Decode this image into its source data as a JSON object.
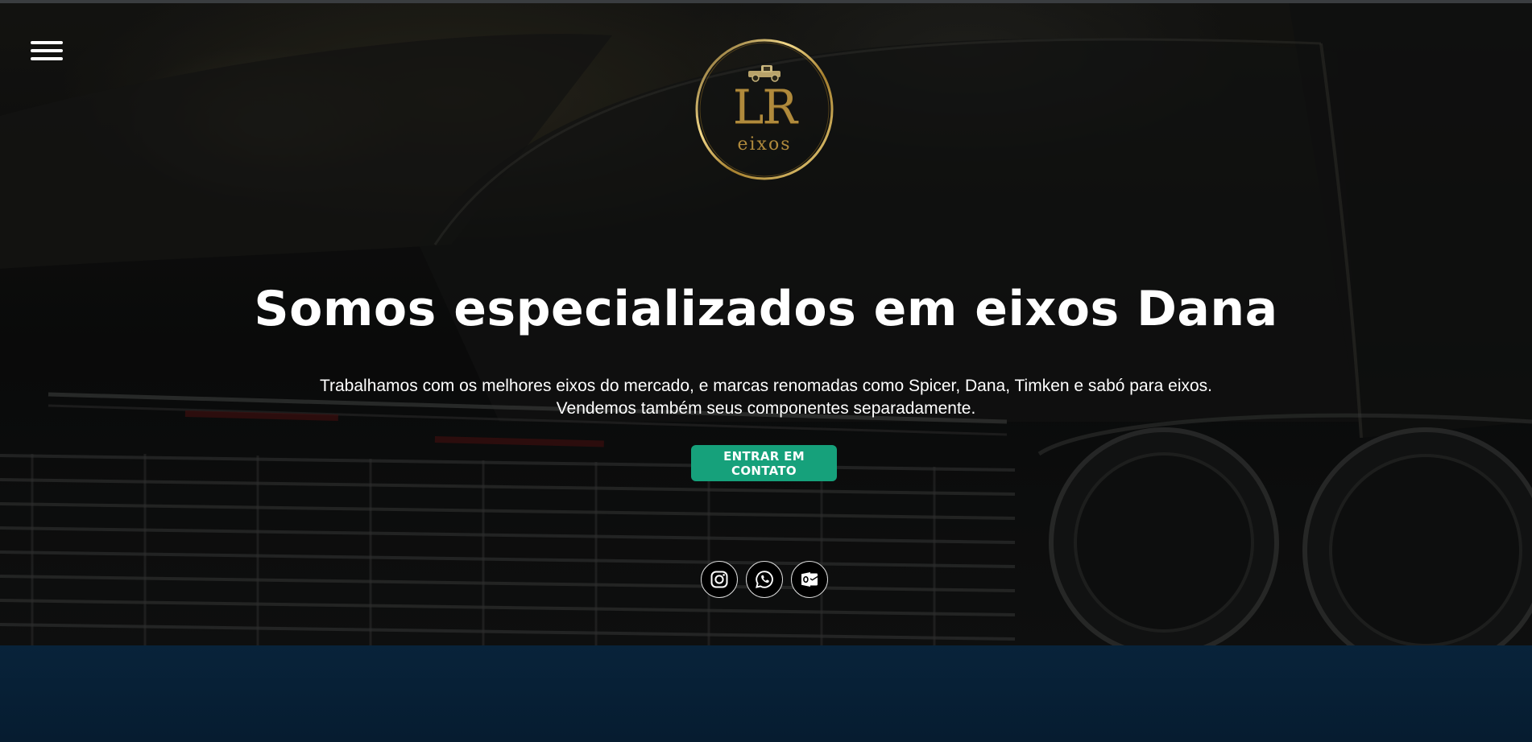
{
  "header": {
    "menu_icon": "hamburger-menu-icon"
  },
  "logo": {
    "monogram": "LR",
    "subtitle": "eixos",
    "emblem_icon": "pickup-truck-icon",
    "ring_color": "#b08a3c"
  },
  "hero": {
    "headline": "Somos especializados em eixos Dana",
    "description_line1": "Trabalhamos com os melhores eixos do mercado, e marcas renomadas como Spicer, Dana, Timken e sabó para eixos.",
    "description_line2": "Vendemos também seus componentes separadamente.",
    "cta_label": "ENTRAR EM CONTATO",
    "cta_color": "#16a17b"
  },
  "social": {
    "items": [
      {
        "name": "Instagram",
        "icon": "instagram-icon"
      },
      {
        "name": "WhatsApp",
        "icon": "whatsapp-icon"
      },
      {
        "name": "Outlook",
        "icon": "outlook-mail-icon"
      }
    ]
  },
  "colors": {
    "lower_section_bg": "#08233a",
    "text": "#ffffff"
  }
}
